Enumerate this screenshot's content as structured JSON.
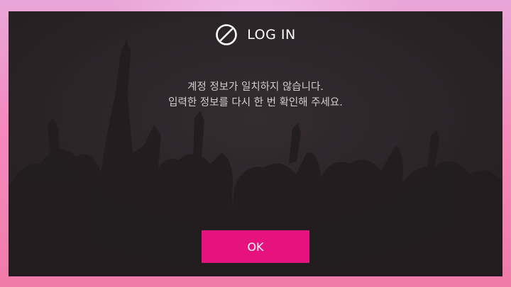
{
  "dialog": {
    "title": "LOG IN",
    "title_icon": "prohibited-icon",
    "message_lines": [
      "계정 정보가 일치하지 않습니다.",
      "입력한 정보를 다시 한 번 확인해 주세요."
    ],
    "ok_label": "OK"
  },
  "colors": {
    "accent": "#e6137f",
    "dialog_background": "#2c2528",
    "message_text": "#d2cfd0"
  }
}
